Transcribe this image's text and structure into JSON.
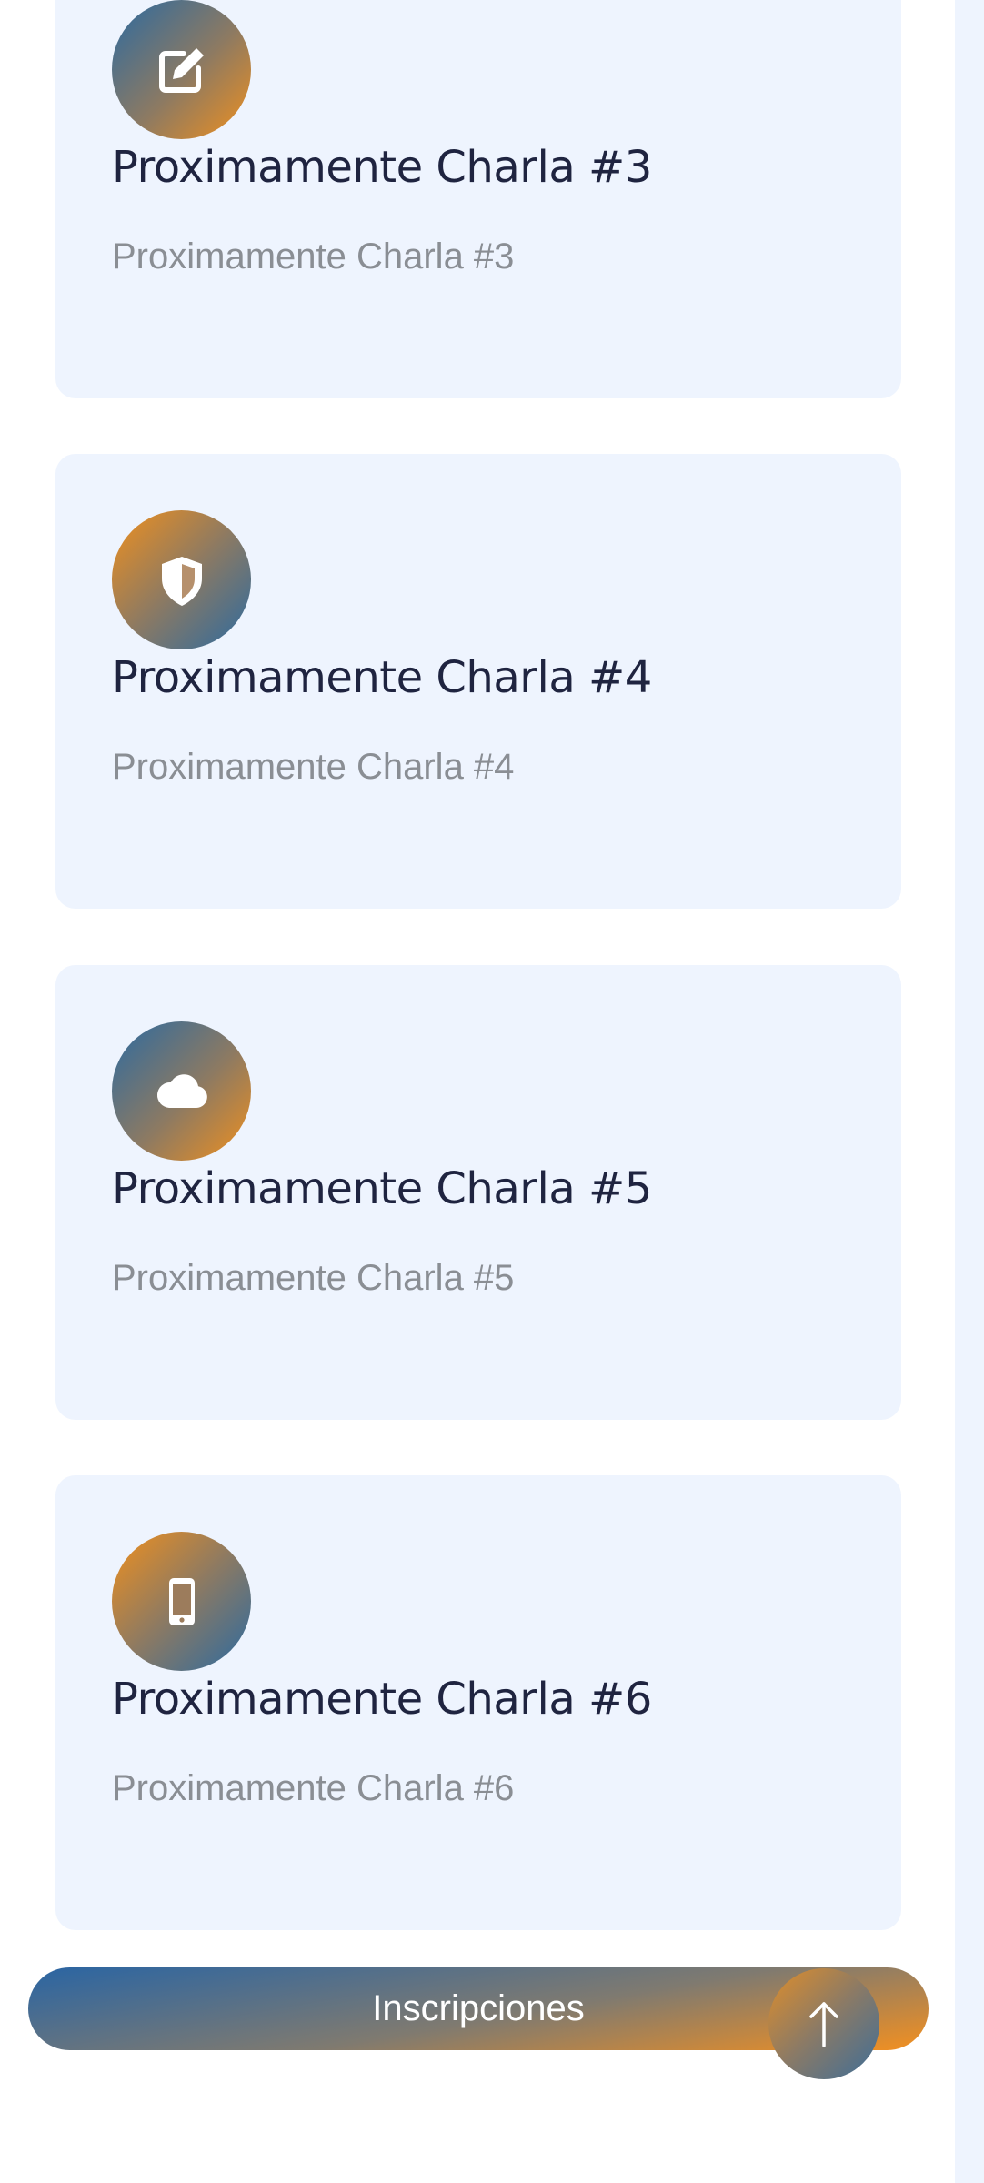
{
  "cards": [
    {
      "icon": "edit-icon",
      "title": "Proximamente Charla #3",
      "description": "Proximamente Charla #3"
    },
    {
      "icon": "shield-icon",
      "title": "Proximamente Charla #4",
      "description": "Proximamente Charla #4"
    },
    {
      "icon": "cloud-icon",
      "title": "Proximamente Charla #5",
      "description": "Proximamente Charla #5"
    },
    {
      "icon": "mobile-icon",
      "title": "Proximamente Charla #6",
      "description": "Proximamente Charla #6"
    }
  ],
  "cta": {
    "label": "Inscripciones"
  },
  "scroll_top": {
    "icon": "arrow-up-icon"
  },
  "colors": {
    "card_background": "#eef4fe",
    "title": "#1f2440",
    "description": "#8a8e94",
    "gradient_blue": "#2c6aa0",
    "gradient_orange": "#f0901e"
  }
}
